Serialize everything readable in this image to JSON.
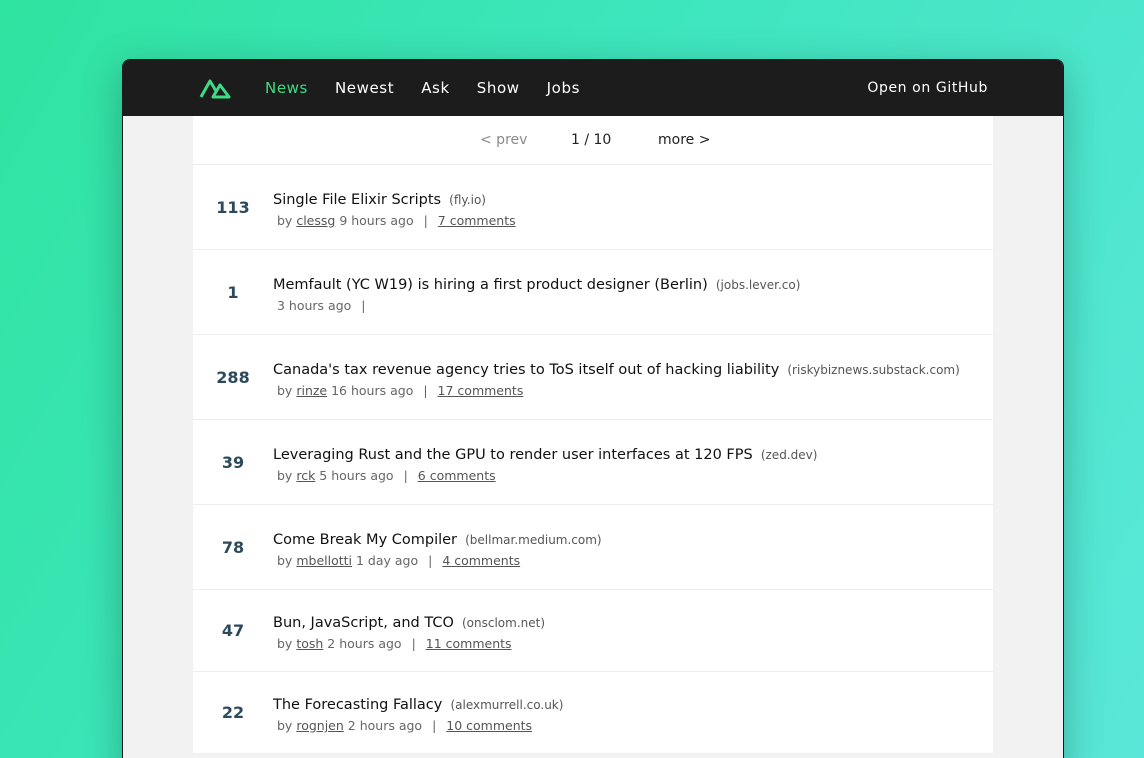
{
  "header": {
    "nav": [
      "News",
      "Newest",
      "Ask",
      "Show",
      "Jobs"
    ],
    "github_label": "Open on GitHub",
    "accent": "#3ddc84"
  },
  "pager": {
    "prev": "< prev",
    "page": "1 / 10",
    "more": "more >"
  },
  "items": [
    {
      "score": "113",
      "title": "Single File Elixir Scripts",
      "host": "(fly.io)",
      "by_prefix": "by",
      "user": "clessg",
      "time": "9 hours ago",
      "sep": "|",
      "comments": "7 comments"
    },
    {
      "score": "1",
      "title": "Memfault (YC W19) is hiring a first product designer (Berlin)",
      "host": "(jobs.lever.co)",
      "time": "3 hours ago",
      "sep": "|"
    },
    {
      "score": "288",
      "title": "Canada's tax revenue agency tries to ToS itself out of hacking liability",
      "host": "(riskybiznews.substack.com)",
      "by_prefix": "by",
      "user": "rinze",
      "time": "16 hours ago",
      "sep": "|",
      "comments": "17 comments"
    },
    {
      "score": "39",
      "title": "Leveraging Rust and the GPU to render user interfaces at 120 FPS",
      "host": "(zed.dev)",
      "by_prefix": "by",
      "user": "rck",
      "time": "5 hours ago",
      "sep": "|",
      "comments": "6 comments"
    },
    {
      "score": "78",
      "title": "Come Break My Compiler",
      "host": "(bellmar.medium.com)",
      "by_prefix": "by",
      "user": "mbellotti",
      "time": "1 day ago",
      "sep": "|",
      "comments": "4 comments"
    },
    {
      "score": "47",
      "title": "Bun, JavaScript, and TCO",
      "host": "(onsclom.net)",
      "by_prefix": "by",
      "user": "tosh",
      "time": "2 hours ago",
      "sep": "|",
      "comments": "11 comments"
    },
    {
      "score": "22",
      "title": "The Forecasting Fallacy",
      "host": "(alexmurrell.co.uk)",
      "by_prefix": "by",
      "user": "rognjen",
      "time": "2 hours ago",
      "sep": "|",
      "comments": "10 comments"
    }
  ]
}
